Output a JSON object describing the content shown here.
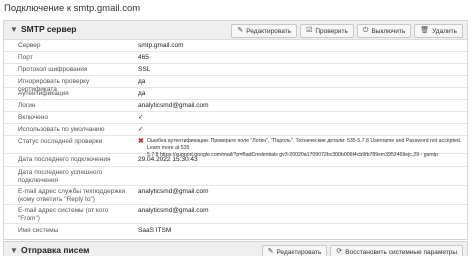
{
  "page": {
    "title": "Подключение к smtp.gmail.com"
  },
  "smtp_panel": {
    "title": "SMTP сервер",
    "chevron_icon": "chevron-down-icon",
    "actions": [
      {
        "label": "Редактировать",
        "icon": "pencil-icon"
      },
      {
        "label": "Проверить",
        "icon": "check-box-icon"
      },
      {
        "label": "Выключить",
        "icon": "power-icon"
      },
      {
        "label": "Удалить",
        "icon": "trash-icon"
      }
    ],
    "rows": [
      {
        "label": "Сервер",
        "value": "smtp.gmail.com"
      },
      {
        "label": "Порт",
        "value": "465"
      },
      {
        "label": "Протокол шифрования",
        "value": "SSL"
      },
      {
        "label": "Игнорировать проверку сертификата",
        "value": "да"
      },
      {
        "label": "Аутентификация",
        "value": "да"
      },
      {
        "label": "Логин",
        "value": "analyticsmd@gmail.com"
      },
      {
        "label": "Включено",
        "value": "✓"
      },
      {
        "label": "Использовать по умолчанию",
        "value": "✓"
      },
      {
        "label": "Статус последней проверки",
        "error_line1": "Ошибка аутентификации. Проверьте поле \"Логин\", \"Пароль\". Технические детали: 535-5.7.8 Username and Password not accepted. Learn more at 535",
        "error_line2": "5.7.8 https://support.google.com/mail/?p=BadCredentials gv3-20020a1709072bc300b006f4cb9fb789sm3952469ejc.29 - gsmtp"
      },
      {
        "label": "Дата последнего подключения",
        "value": "29.04.2022 15:30:43"
      },
      {
        "label": "Дата последнего успешного подключения",
        "value": ""
      },
      {
        "label": "E-mail адрес службы техподдержки (кому ответить \"Reply to\")",
        "value": "analyticsmd@gmail.com"
      },
      {
        "label": "E-mail адрес системы (от кого \"From\")",
        "value": "analyticsmd@gmail.com"
      },
      {
        "label": "Имя системы",
        "value": "SaaS ITSM"
      }
    ]
  },
  "send_panel": {
    "title": "Отправка писем",
    "chevron_icon": "chevron-down-icon",
    "actions": [
      {
        "label": "Редактировать",
        "icon": "pencil-icon"
      },
      {
        "label": "Восстановить системные параметры",
        "icon": "restore-icon"
      }
    ]
  }
}
